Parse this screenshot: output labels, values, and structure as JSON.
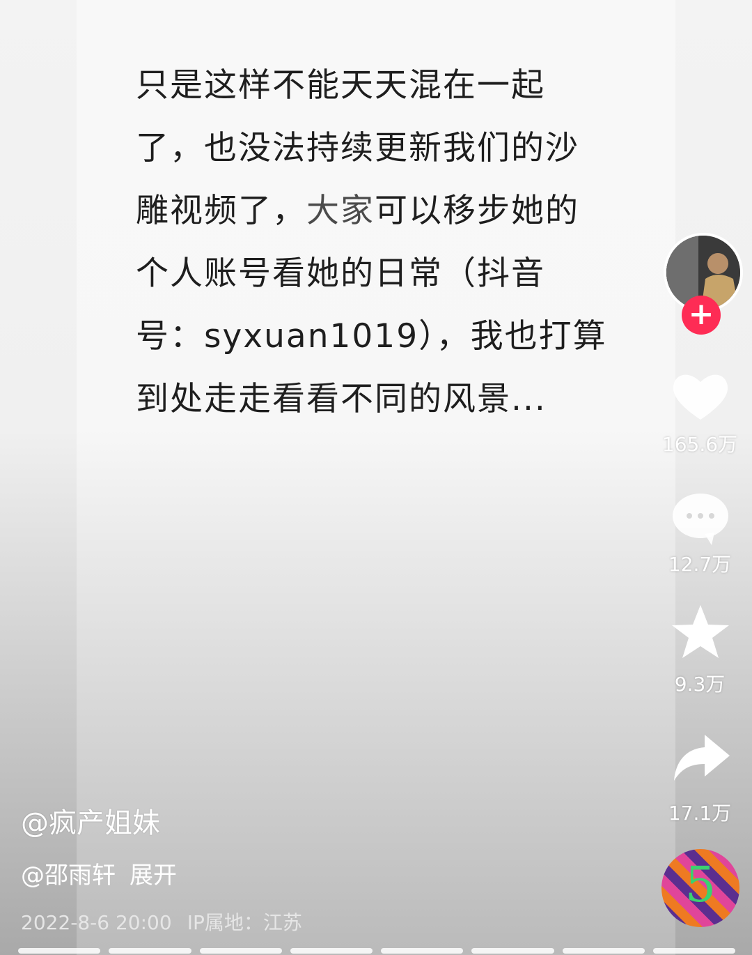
{
  "post": {
    "lines": [
      "只是这样不能天天混在一起",
      "了，也没法持续更新我们的沙",
      "雕视频了，",
      "大家",
      "可以移步她的",
      "个人账号看她的日常（抖音",
      "号：syxuan1019），我也打算",
      "到处走走看看不同的风景..."
    ]
  },
  "rail": {
    "follow_symbol": "+",
    "like_count": "165.6万",
    "comment_count": "12.7万",
    "favorite_count": "9.3万",
    "share_count": "17.1万",
    "music_disc_label": "5"
  },
  "caption": {
    "author": "@疯产姐妹",
    "mention": "@邵雨轩",
    "expand": "展开",
    "date": "2022-8-6 20:00",
    "ip": "IP属地：江苏"
  },
  "colors": {
    "follow_button": "#fe2c55",
    "text": "#1e1e1e"
  },
  "icons": [
    "heart-icon",
    "comment-icon",
    "star-icon",
    "share-icon"
  ]
}
